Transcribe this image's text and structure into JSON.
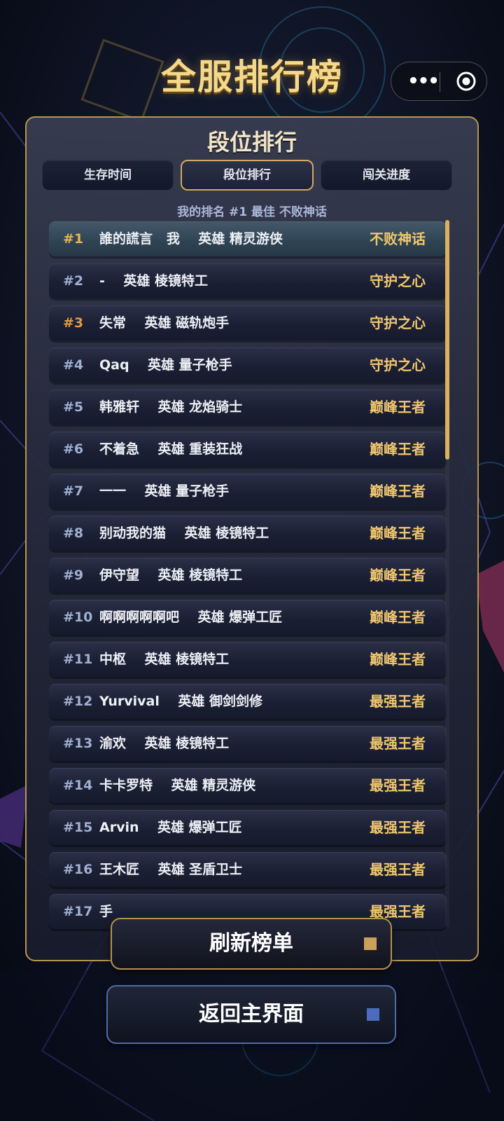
{
  "page_title": "全服排行榜",
  "capsule": {
    "more_icon": "more-dots-icon",
    "close_icon": "target-circle-icon"
  },
  "panel": {
    "title": "段位排行",
    "tabs": [
      {
        "label": "生存时间",
        "active": false
      },
      {
        "label": "段位排行",
        "active": true
      },
      {
        "label": "闯关进度",
        "active": false
      }
    ],
    "my_rank": "我的排名 #1  最佳 不败神话"
  },
  "leaderboard": [
    {
      "rank": "#1",
      "name": "誰的謊言   我    英雄 精灵游侠",
      "tier": "不败神话",
      "rank_color": "#e9b54f"
    },
    {
      "rank": "#2",
      "name": "-    英雄 棱镜特工",
      "tier": "守护之心",
      "rank_color": "#9fb0d2"
    },
    {
      "rank": "#3",
      "name": "失常    英雄 磁轨炮手",
      "tier": "守护之心",
      "rank_color": "#e39a3f"
    },
    {
      "rank": "#4",
      "name": "Qaq    英雄 量子枪手",
      "tier": "守护之心",
      "rank_color": "#9fb0d2"
    },
    {
      "rank": "#5",
      "name": "韩雅轩    英雄 龙焰骑士",
      "tier": "巅峰王者",
      "rank_color": "#9fb0d2"
    },
    {
      "rank": "#6",
      "name": "不着急    英雄 重装狂战",
      "tier": "巅峰王者",
      "rank_color": "#9fb0d2"
    },
    {
      "rank": "#7",
      "name": "一一    英雄 量子枪手",
      "tier": "巅峰王者",
      "rank_color": "#9fb0d2"
    },
    {
      "rank": "#8",
      "name": "别动我的猫    英雄 棱镜特工",
      "tier": "巅峰王者",
      "rank_color": "#9fb0d2"
    },
    {
      "rank": "#9",
      "name": "伊守望    英雄 棱镜特工",
      "tier": "巅峰王者",
      "rank_color": "#9fb0d2"
    },
    {
      "rank": "#10",
      "name": "啊啊啊啊啊吧    英雄 爆弹工匠",
      "tier": "巅峰王者",
      "rank_color": "#9fb0d2"
    },
    {
      "rank": "#11",
      "name": "中枢    英雄 棱镜特工",
      "tier": "巅峰王者",
      "rank_color": "#9fb0d2"
    },
    {
      "rank": "#12",
      "name": "Yurvival    英雄 御剑剑修",
      "tier": "最强王者",
      "rank_color": "#9fb0d2"
    },
    {
      "rank": "#13",
      "name": "渝欢    英雄 棱镜特工",
      "tier": "最强王者",
      "rank_color": "#9fb0d2"
    },
    {
      "rank": "#14",
      "name": "卡卡罗特    英雄 精灵游侠",
      "tier": "最强王者",
      "rank_color": "#9fb0d2"
    },
    {
      "rank": "#15",
      "name": "Arvin    英雄 爆弹工匠",
      "tier": "最强王者",
      "rank_color": "#9fb0d2"
    },
    {
      "rank": "#16",
      "name": "王木匠    英雄 圣盾卫士",
      "tier": "最强王者",
      "rank_color": "#9fb0d2"
    },
    {
      "rank": "#17",
      "name": "手",
      "tier": "最强王者",
      "rank_color": "#9fb0d2"
    }
  ],
  "buttons": {
    "refresh_label": "刷新榜单",
    "back_label": "返回主界面"
  },
  "colors": {
    "accent_gold": "#cfa961",
    "tier_gold": "#f1c76e",
    "back_blue": "#4f6ba8"
  }
}
